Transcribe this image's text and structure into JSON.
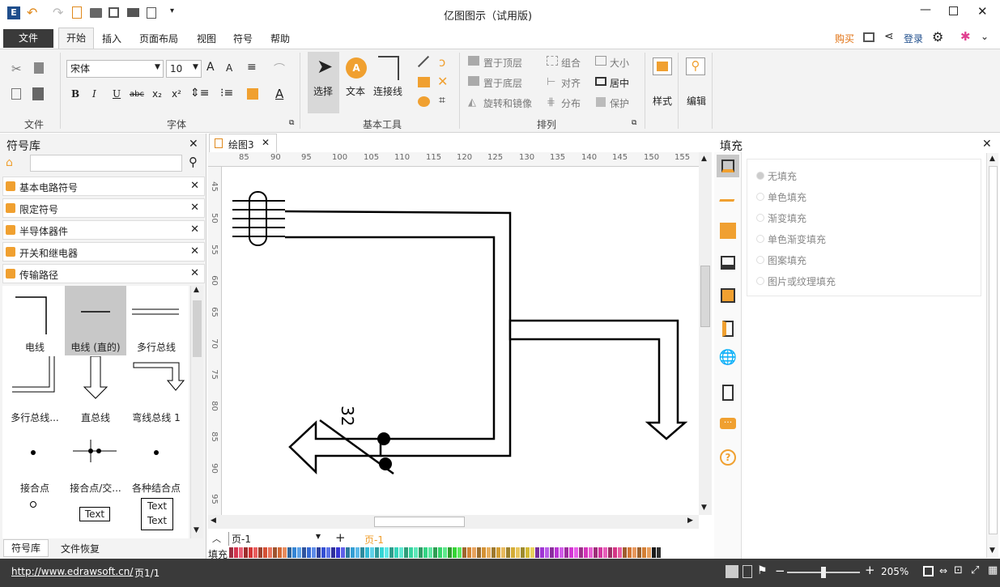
{
  "window": {
    "title": "亿图图示（试用版)"
  },
  "menu": {
    "file": "文件",
    "home": "开始",
    "insert": "插入",
    "layout": "页面布局",
    "view": "视图",
    "symbol": "符号",
    "help": "帮助",
    "buy": "购买",
    "login": "登录"
  },
  "ribbon": {
    "font_name": "宋体",
    "font_size": "10",
    "groups": {
      "file": "文件",
      "font": "字体",
      "basic_tools": "基本工具",
      "arrange": "排列"
    },
    "select": "选择",
    "text": "文本",
    "connector": "连接线",
    "bring_front": "置于顶层",
    "send_back": "置于底层",
    "rotate_mirror": "旋转和镜像",
    "group": "组合",
    "align": "对齐",
    "distribute": "分布",
    "size": "大小",
    "center": "居中",
    "protect": "保护",
    "style": "样式",
    "edit": "编辑"
  },
  "library": {
    "title": "符号库",
    "categories": [
      "基本电路符号",
      "限定符号",
      "半导体器件",
      "开关和继电器",
      "传输路径"
    ],
    "symbols": [
      "电线",
      "电线 (直的)",
      "多行总线",
      "多行总线...",
      "直总线",
      "弯线总线 1",
      "接合点",
      "接合点/交...",
      "各种结合点"
    ],
    "text_sample": "Text",
    "bottom_tabs": [
      "符号库",
      "文件恢复"
    ]
  },
  "document": {
    "tab": "绘图3",
    "page_select": "页-1",
    "page_tab": "页-1",
    "fill_label": "填充",
    "annotation": "32"
  },
  "ruler": {
    "h": [
      "85",
      "90",
      "95",
      "100",
      "105",
      "110",
      "115",
      "120",
      "125",
      "130",
      "135",
      "140",
      "145",
      "150",
      "155"
    ],
    "v": [
      "45",
      "50",
      "55",
      "60",
      "65",
      "70",
      "75",
      "80",
      "85",
      "90",
      "95"
    ]
  },
  "fill_panel": {
    "title": "填充",
    "options": [
      "无填充",
      "单色填充",
      "渐变填充",
      "单色渐变填充",
      "图案填充",
      "图片或纹理填充"
    ]
  },
  "status": {
    "url": "http://www.edrawsoft.cn/",
    "page": "页1/1",
    "zoom": "205%"
  },
  "colors": {
    "accent": "#f0a030",
    "dark": "#3a3a3a",
    "selected_symbol": "#c8c8c8"
  }
}
